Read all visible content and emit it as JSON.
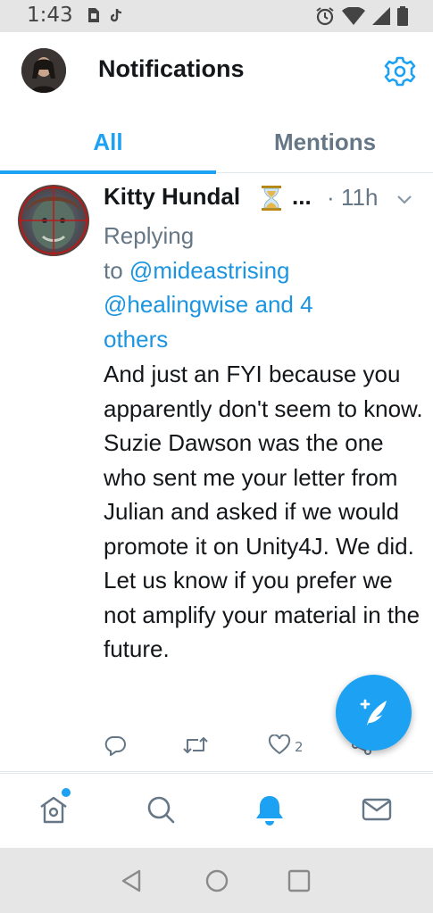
{
  "status_bar": {
    "time": "1:43",
    "left_icons": [
      "sim-card-icon",
      "tiktok-icon"
    ],
    "right_icons": [
      "alarm-icon",
      "wifi-icon",
      "signal-icon",
      "battery-icon"
    ]
  },
  "header": {
    "title": "Notifications",
    "avatar_icon": "profile-avatar",
    "settings_icon": "gear-icon"
  },
  "tabs": [
    {
      "label": "All",
      "active": true
    },
    {
      "label": "Mentions",
      "active": false
    }
  ],
  "tweet": {
    "author_name": "Kitty Hundal",
    "name_emoji_icon": "hourglass-icon",
    "name_truncation": "...",
    "separator": "·",
    "time": "11h",
    "replying_label": "Replying",
    "to_label": "to",
    "mentions_line1": "@mideastrising",
    "mentions_line2": "@healingwise and 4",
    "mentions_line3": "others",
    "body": "And just an FYI because you apparently don't seem to know. Suzie Dawson was the one who sent me your letter from Julian and asked if we would promote it on Unity4J. We did. Let us know if you prefer we not amplify your material in the future.",
    "like_count": "2"
  },
  "fab": {
    "icon": "compose-icon"
  },
  "bottom_nav": [
    {
      "icon": "home-icon",
      "has_badge": true
    },
    {
      "icon": "search-icon"
    },
    {
      "icon": "bell-icon",
      "active": true
    },
    {
      "icon": "mail-icon"
    }
  ],
  "android_nav": [
    "back-icon",
    "home-circle-icon",
    "recents-icon"
  ],
  "colors": {
    "accent": "#1da1f2",
    "link": "#1b95e0",
    "secondary_text": "#657786",
    "primary_text": "#14171a",
    "divider": "#e1e8ed"
  }
}
